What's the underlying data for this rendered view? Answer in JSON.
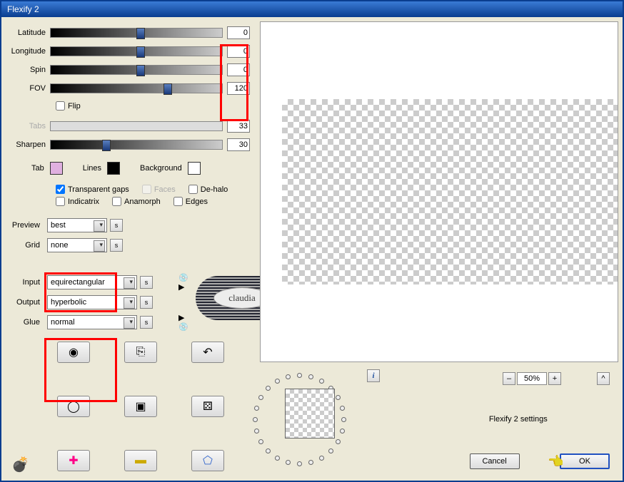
{
  "window_title": "Flexify 2",
  "sliders": {
    "latitude": {
      "label": "Latitude",
      "value": "0",
      "thumb_pct": 50
    },
    "longitude": {
      "label": "Longitude",
      "value": "0",
      "thumb_pct": 50
    },
    "spin": {
      "label": "Spin",
      "value": "0",
      "thumb_pct": 50
    },
    "fov": {
      "label": "FOV",
      "value": "120",
      "thumb_pct": 66
    },
    "tabs": {
      "label": "Tabs",
      "value": "33",
      "thumb_pct": 33,
      "disabled": true
    },
    "sharpen": {
      "label": "Sharpen",
      "value": "30",
      "thumb_pct": 30
    }
  },
  "flip": {
    "label": "Flip",
    "checked": false
  },
  "colors": {
    "tab_label": "Tab",
    "tab_color": "#e0b0e0",
    "lines_label": "Lines",
    "lines_color": "#000000",
    "background_label": "Background",
    "background_color": "#ffffff"
  },
  "checks": {
    "transparent_gaps": {
      "label": "Transparent gaps",
      "checked": true
    },
    "faces": {
      "label": "Faces",
      "checked": false,
      "faded": true
    },
    "dehalo": {
      "label": "De-halo",
      "checked": false
    },
    "indicatrix": {
      "label": "Indicatrix",
      "checked": false
    },
    "anamorph": {
      "label": "Anamorph",
      "checked": false
    },
    "edges": {
      "label": "Edges",
      "checked": false
    }
  },
  "combos": {
    "preview": {
      "label": "Preview",
      "value": "best"
    },
    "grid": {
      "label": "Grid",
      "value": "none"
    },
    "input": {
      "label": "Input",
      "value": "equirectangular"
    },
    "output": {
      "label": "Output",
      "value": "hyperbolic"
    },
    "glue": {
      "label": "Glue",
      "value": "normal"
    }
  },
  "s_btn": "s",
  "zoom": {
    "value": "50%",
    "minus": "–",
    "plus": "+",
    "caret": "^"
  },
  "info": "i",
  "settings_label": "Flexify 2 settings",
  "buttons": {
    "cancel": "Cancel",
    "ok": "OK"
  },
  "watermark": "claudia",
  "icons": {
    "tool_1": "◉",
    "tool_2": "⎘",
    "tool_3": "↶",
    "tool_4": "◯",
    "tool_5": "▣",
    "tool_6": "⚄",
    "tool_7": "✚",
    "tool_8": "▬",
    "tool_9": "⬠",
    "burn": "💣",
    "hand": "👉",
    "disc_play": "💿▶",
    "play_disc": "▶💿"
  }
}
